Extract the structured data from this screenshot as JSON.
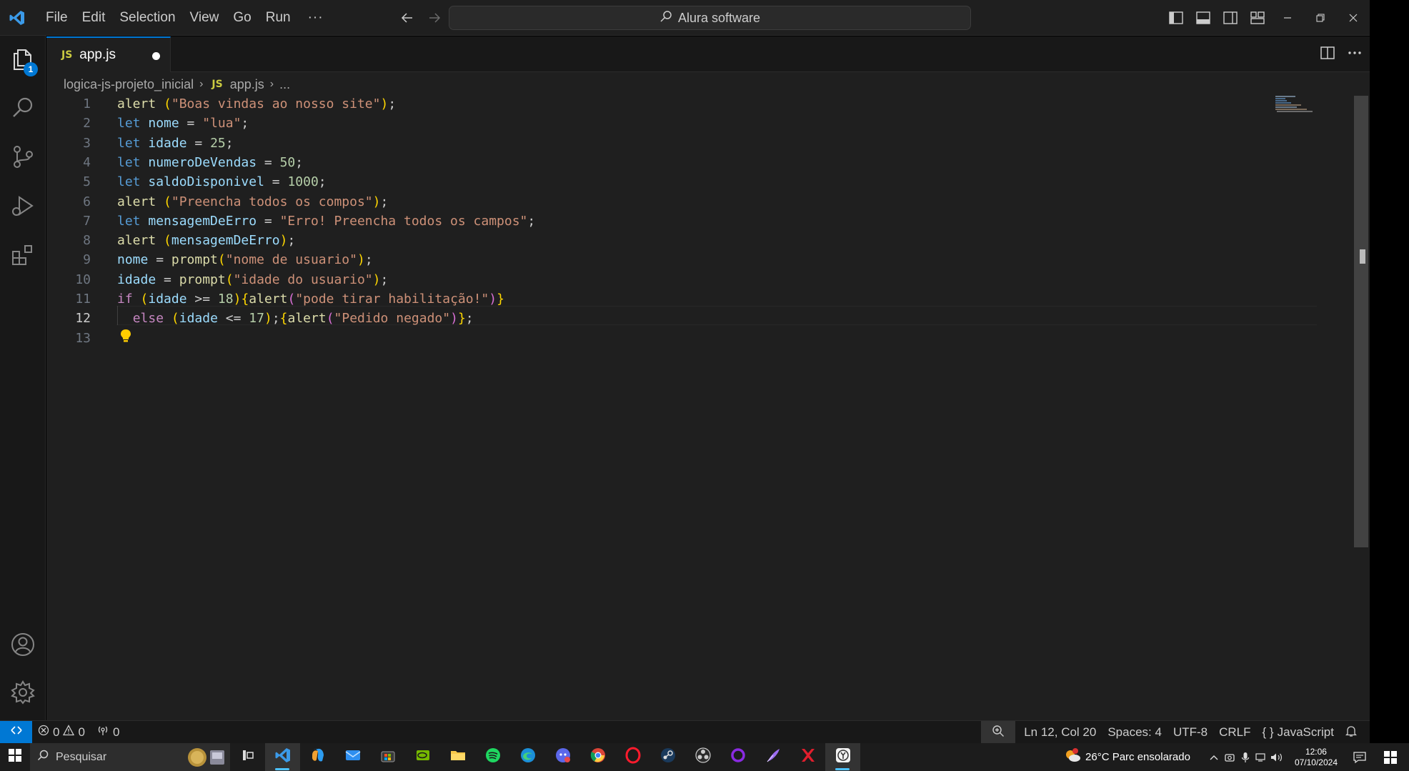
{
  "menu": [
    "File",
    "Edit",
    "Selection",
    "View",
    "Go",
    "Run"
  ],
  "menu_more": "···",
  "command_center": "Alura software",
  "explorer_badge": "1",
  "tab": {
    "label": "JS",
    "name": "app.js"
  },
  "breadcrumb": {
    "folder": "logica-js-projeto_inicial",
    "file_icon": "JS",
    "file": "app.js",
    "more": "..."
  },
  "code": {
    "lines": [
      [
        {
          "t": "alert",
          "c": "fn"
        },
        {
          "t": " ",
          "c": "pl"
        },
        {
          "t": "(",
          "c": "br1"
        },
        {
          "t": "\"Boas vindas ao nosso site\"",
          "c": "str"
        },
        {
          "t": ")",
          "c": "br1"
        },
        {
          "t": ";",
          "c": "pl"
        }
      ],
      [
        {
          "t": "let",
          "c": "kw"
        },
        {
          "t": " ",
          "c": "pl"
        },
        {
          "t": "nome",
          "c": "var"
        },
        {
          "t": " = ",
          "c": "pl"
        },
        {
          "t": "\"lua\"",
          "c": "str"
        },
        {
          "t": ";",
          "c": "pl"
        }
      ],
      [
        {
          "t": "let",
          "c": "kw"
        },
        {
          "t": " ",
          "c": "pl"
        },
        {
          "t": "idade",
          "c": "var"
        },
        {
          "t": " = ",
          "c": "pl"
        },
        {
          "t": "25",
          "c": "num"
        },
        {
          "t": ";",
          "c": "pl"
        }
      ],
      [
        {
          "t": "let",
          "c": "kw"
        },
        {
          "t": " ",
          "c": "pl"
        },
        {
          "t": "numeroDeVendas",
          "c": "var"
        },
        {
          "t": " = ",
          "c": "pl"
        },
        {
          "t": "50",
          "c": "num"
        },
        {
          "t": ";",
          "c": "pl"
        }
      ],
      [
        {
          "t": "let",
          "c": "kw"
        },
        {
          "t": " ",
          "c": "pl"
        },
        {
          "t": "saldoDisponivel",
          "c": "var"
        },
        {
          "t": " = ",
          "c": "pl"
        },
        {
          "t": "1000",
          "c": "num"
        },
        {
          "t": ";",
          "c": "pl"
        }
      ],
      [
        {
          "t": "alert",
          "c": "fn"
        },
        {
          "t": " ",
          "c": "pl"
        },
        {
          "t": "(",
          "c": "br1"
        },
        {
          "t": "\"Preencha todos os compos\"",
          "c": "str"
        },
        {
          "t": ")",
          "c": "br1"
        },
        {
          "t": ";",
          "c": "pl"
        }
      ],
      [
        {
          "t": "let",
          "c": "kw"
        },
        {
          "t": " ",
          "c": "pl"
        },
        {
          "t": "mensagemDeErro",
          "c": "var"
        },
        {
          "t": " = ",
          "c": "pl"
        },
        {
          "t": "\"Erro! Preencha todos os campos\"",
          "c": "str"
        },
        {
          "t": ";",
          "c": "pl"
        }
      ],
      [
        {
          "t": "alert",
          "c": "fn"
        },
        {
          "t": " ",
          "c": "pl"
        },
        {
          "t": "(",
          "c": "br1"
        },
        {
          "t": "mensagemDeErro",
          "c": "var"
        },
        {
          "t": ")",
          "c": "br1"
        },
        {
          "t": ";",
          "c": "pl"
        }
      ],
      [
        {
          "t": "nome",
          "c": "var"
        },
        {
          "t": " = ",
          "c": "pl"
        },
        {
          "t": "prompt",
          "c": "fn"
        },
        {
          "t": "(",
          "c": "br1"
        },
        {
          "t": "\"nome de usuario\"",
          "c": "str"
        },
        {
          "t": ")",
          "c": "br1"
        },
        {
          "t": ";",
          "c": "pl"
        }
      ],
      [
        {
          "t": "idade",
          "c": "var"
        },
        {
          "t": " = ",
          "c": "pl"
        },
        {
          "t": "prompt",
          "c": "fn"
        },
        {
          "t": "(",
          "c": "br1"
        },
        {
          "t": "\"idade do usuario\"",
          "c": "str"
        },
        {
          "t": ")",
          "c": "br1"
        },
        {
          "t": ";",
          "c": "pl"
        }
      ],
      [
        {
          "t": "if",
          "c": "ctl"
        },
        {
          "t": " ",
          "c": "pl"
        },
        {
          "t": "(",
          "c": "br1"
        },
        {
          "t": "idade",
          "c": "var"
        },
        {
          "t": " >= ",
          "c": "pl"
        },
        {
          "t": "18",
          "c": "num"
        },
        {
          "t": ")",
          "c": "br1"
        },
        {
          "t": "{",
          "c": "br1"
        },
        {
          "t": "alert",
          "c": "fn"
        },
        {
          "t": "(",
          "c": "br2"
        },
        {
          "t": "\"pode tirar habilitação!\"",
          "c": "str"
        },
        {
          "t": ")",
          "c": "br2"
        },
        {
          "t": "}",
          "c": "br1"
        }
      ],
      [
        {
          "t": "  ",
          "c": "pl"
        },
        {
          "t": "else",
          "c": "ctl"
        },
        {
          "t": " ",
          "c": "pl"
        },
        {
          "t": "(",
          "c": "br1"
        },
        {
          "t": "idade",
          "c": "var"
        },
        {
          "t": " <= ",
          "c": "pl"
        },
        {
          "t": "17",
          "c": "num"
        },
        {
          "t": ")",
          "c": "br1"
        },
        {
          "t": ";",
          "c": "pl"
        },
        {
          "t": "{",
          "c": "br1"
        },
        {
          "t": "alert",
          "c": "fn"
        },
        {
          "t": "(",
          "c": "br2"
        },
        {
          "t": "\"Pedido negado\"",
          "c": "str"
        },
        {
          "t": ")",
          "c": "br2"
        },
        {
          "t": "}",
          "c": "br1"
        },
        {
          "t": ";",
          "c": "pl"
        }
      ],
      []
    ],
    "active_line": 12
  },
  "status": {
    "errors": "0",
    "warnings": "0",
    "ports": "0",
    "position": "Ln 12, Col 20",
    "spaces": "Spaces: 4",
    "encoding": "UTF-8",
    "eol": "CRLF",
    "language": "JavaScript"
  },
  "taskbar": {
    "search_placeholder": "Pesquisar",
    "weather": "26°C  Parc ensolarado",
    "time": "12:06",
    "date": "07/10/2024"
  },
  "colors": {
    "accent": "#0078d4",
    "editor_bg": "#1f1f1f",
    "keyword": "#569cd6",
    "function": "#dcdcaa",
    "string": "#ce9178",
    "number": "#b5cea8",
    "variable": "#9cdcfe",
    "control": "#c586c0"
  }
}
